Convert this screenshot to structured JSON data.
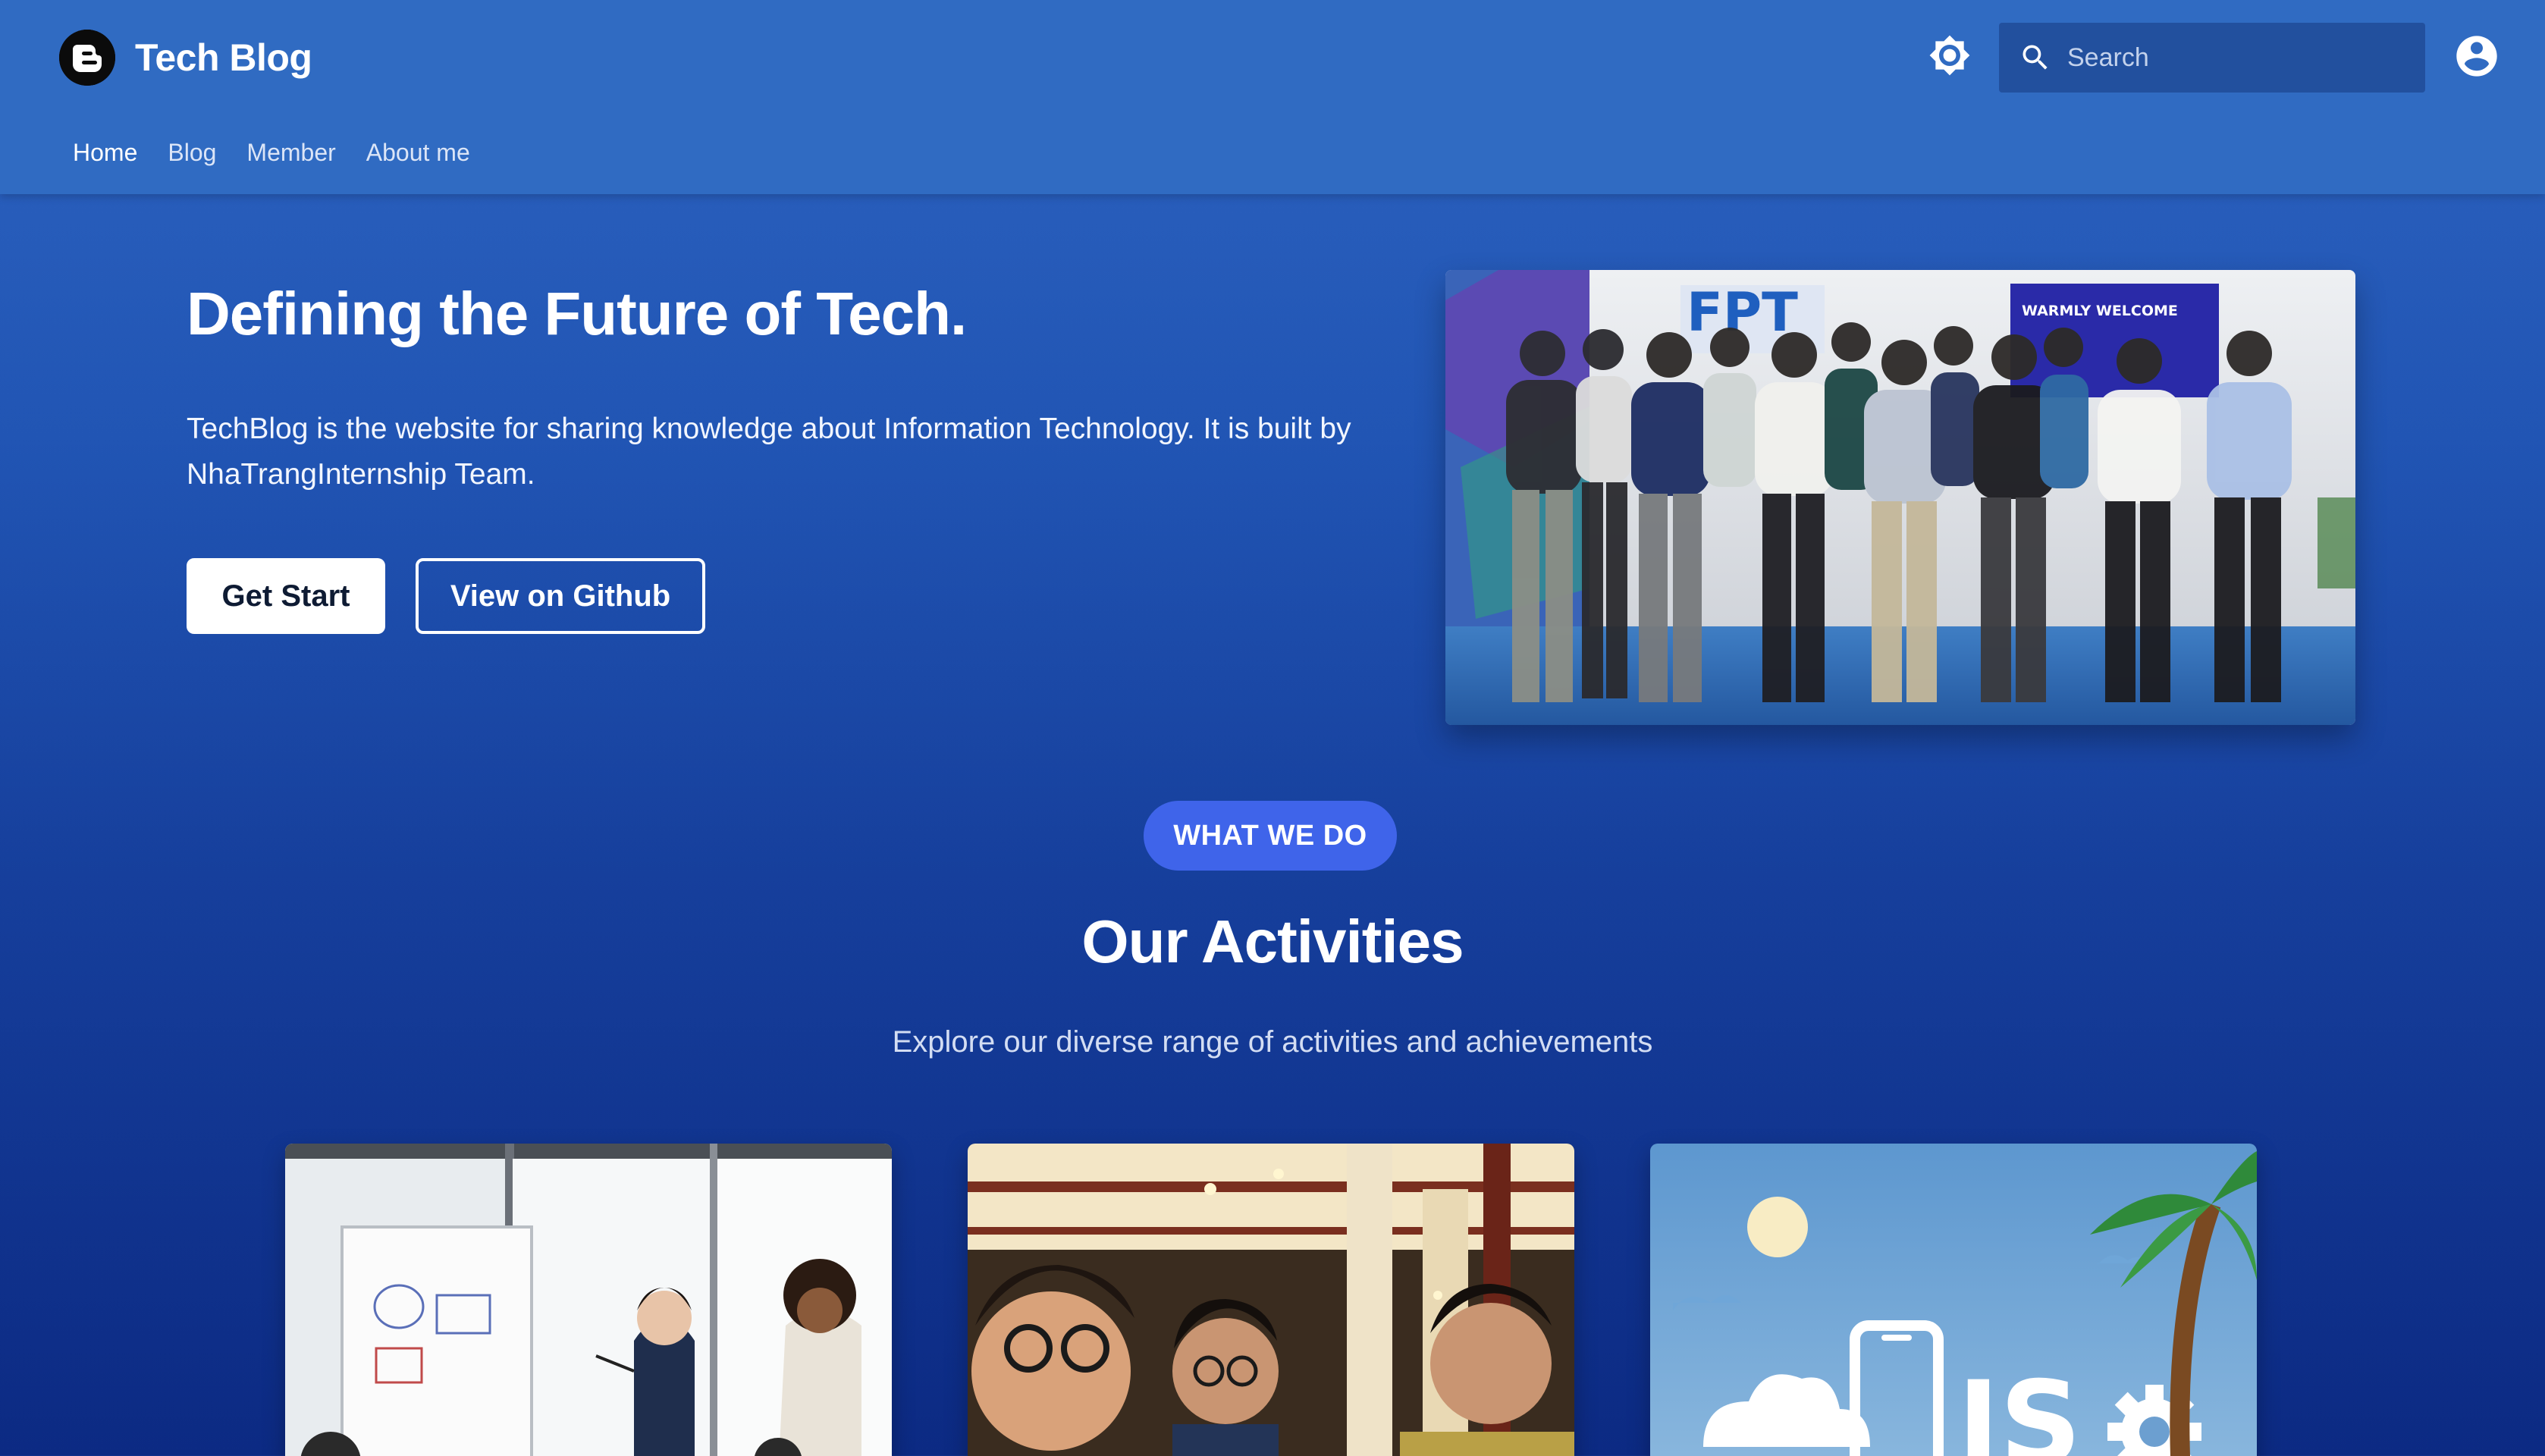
{
  "header": {
    "brand_title": "Tech Blog",
    "brand_icon": "blogger-icon",
    "theme_icon": "sun-icon",
    "account_icon": "account-circle-icon",
    "search": {
      "placeholder": "Search",
      "value": ""
    },
    "nav": [
      {
        "label": "Home",
        "active": true
      },
      {
        "label": "Blog",
        "active": false
      },
      {
        "label": "Member",
        "active": false
      },
      {
        "label": "About me",
        "active": false
      }
    ]
  },
  "hero": {
    "title": "Defining the Future of Tech.",
    "description": "TechBlog is the website for sharing knowledge about Information Technology. It is built by NhaTrangInternship Team.",
    "primary_button": "Get Start",
    "secondary_button": "View on Github",
    "image_banner_text": "WARMLY WELCOME"
  },
  "activities": {
    "badge": "WHAT WE DO",
    "title": "Our Activities",
    "subtitle": "Explore our diverse range of activities and achievements",
    "cards": [
      {
        "image": "office-meeting-photo"
      },
      {
        "image": "team-selfie-photo"
      },
      {
        "image": "js-mobile-illustration",
        "image_text": "JS"
      }
    ]
  },
  "colors": {
    "header_bg": "#306bc2",
    "page_gradient_top": "#2d63c0",
    "page_gradient_bottom": "#0c2a83",
    "badge_bg": "#3f64ea",
    "search_bg": "#22509e"
  }
}
